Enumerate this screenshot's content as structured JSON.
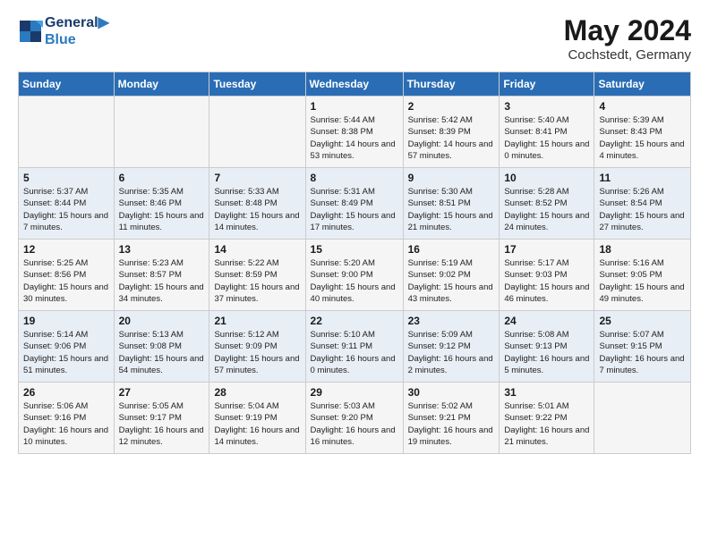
{
  "header": {
    "logo_line1": "General",
    "logo_line2": "Blue",
    "month": "May 2024",
    "location": "Cochstedt, Germany"
  },
  "days_of_week": [
    "Sunday",
    "Monday",
    "Tuesday",
    "Wednesday",
    "Thursday",
    "Friday",
    "Saturday"
  ],
  "weeks": [
    [
      {
        "day": "",
        "info": ""
      },
      {
        "day": "",
        "info": ""
      },
      {
        "day": "",
        "info": ""
      },
      {
        "day": "1",
        "info": "Sunrise: 5:44 AM\nSunset: 8:38 PM\nDaylight: 14 hours and 53 minutes."
      },
      {
        "day": "2",
        "info": "Sunrise: 5:42 AM\nSunset: 8:39 PM\nDaylight: 14 hours and 57 minutes."
      },
      {
        "day": "3",
        "info": "Sunrise: 5:40 AM\nSunset: 8:41 PM\nDaylight: 15 hours and 0 minutes."
      },
      {
        "day": "4",
        "info": "Sunrise: 5:39 AM\nSunset: 8:43 PM\nDaylight: 15 hours and 4 minutes."
      }
    ],
    [
      {
        "day": "5",
        "info": "Sunrise: 5:37 AM\nSunset: 8:44 PM\nDaylight: 15 hours and 7 minutes."
      },
      {
        "day": "6",
        "info": "Sunrise: 5:35 AM\nSunset: 8:46 PM\nDaylight: 15 hours and 11 minutes."
      },
      {
        "day": "7",
        "info": "Sunrise: 5:33 AM\nSunset: 8:48 PM\nDaylight: 15 hours and 14 minutes."
      },
      {
        "day": "8",
        "info": "Sunrise: 5:31 AM\nSunset: 8:49 PM\nDaylight: 15 hours and 17 minutes."
      },
      {
        "day": "9",
        "info": "Sunrise: 5:30 AM\nSunset: 8:51 PM\nDaylight: 15 hours and 21 minutes."
      },
      {
        "day": "10",
        "info": "Sunrise: 5:28 AM\nSunset: 8:52 PM\nDaylight: 15 hours and 24 minutes."
      },
      {
        "day": "11",
        "info": "Sunrise: 5:26 AM\nSunset: 8:54 PM\nDaylight: 15 hours and 27 minutes."
      }
    ],
    [
      {
        "day": "12",
        "info": "Sunrise: 5:25 AM\nSunset: 8:56 PM\nDaylight: 15 hours and 30 minutes."
      },
      {
        "day": "13",
        "info": "Sunrise: 5:23 AM\nSunset: 8:57 PM\nDaylight: 15 hours and 34 minutes."
      },
      {
        "day": "14",
        "info": "Sunrise: 5:22 AM\nSunset: 8:59 PM\nDaylight: 15 hours and 37 minutes."
      },
      {
        "day": "15",
        "info": "Sunrise: 5:20 AM\nSunset: 9:00 PM\nDaylight: 15 hours and 40 minutes."
      },
      {
        "day": "16",
        "info": "Sunrise: 5:19 AM\nSunset: 9:02 PM\nDaylight: 15 hours and 43 minutes."
      },
      {
        "day": "17",
        "info": "Sunrise: 5:17 AM\nSunset: 9:03 PM\nDaylight: 15 hours and 46 minutes."
      },
      {
        "day": "18",
        "info": "Sunrise: 5:16 AM\nSunset: 9:05 PM\nDaylight: 15 hours and 49 minutes."
      }
    ],
    [
      {
        "day": "19",
        "info": "Sunrise: 5:14 AM\nSunset: 9:06 PM\nDaylight: 15 hours and 51 minutes."
      },
      {
        "day": "20",
        "info": "Sunrise: 5:13 AM\nSunset: 9:08 PM\nDaylight: 15 hours and 54 minutes."
      },
      {
        "day": "21",
        "info": "Sunrise: 5:12 AM\nSunset: 9:09 PM\nDaylight: 15 hours and 57 minutes."
      },
      {
        "day": "22",
        "info": "Sunrise: 5:10 AM\nSunset: 9:11 PM\nDaylight: 16 hours and 0 minutes."
      },
      {
        "day": "23",
        "info": "Sunrise: 5:09 AM\nSunset: 9:12 PM\nDaylight: 16 hours and 2 minutes."
      },
      {
        "day": "24",
        "info": "Sunrise: 5:08 AM\nSunset: 9:13 PM\nDaylight: 16 hours and 5 minutes."
      },
      {
        "day": "25",
        "info": "Sunrise: 5:07 AM\nSunset: 9:15 PM\nDaylight: 16 hours and 7 minutes."
      }
    ],
    [
      {
        "day": "26",
        "info": "Sunrise: 5:06 AM\nSunset: 9:16 PM\nDaylight: 16 hours and 10 minutes."
      },
      {
        "day": "27",
        "info": "Sunrise: 5:05 AM\nSunset: 9:17 PM\nDaylight: 16 hours and 12 minutes."
      },
      {
        "day": "28",
        "info": "Sunrise: 5:04 AM\nSunset: 9:19 PM\nDaylight: 16 hours and 14 minutes."
      },
      {
        "day": "29",
        "info": "Sunrise: 5:03 AM\nSunset: 9:20 PM\nDaylight: 16 hours and 16 minutes."
      },
      {
        "day": "30",
        "info": "Sunrise: 5:02 AM\nSunset: 9:21 PM\nDaylight: 16 hours and 19 minutes."
      },
      {
        "day": "31",
        "info": "Sunrise: 5:01 AM\nSunset: 9:22 PM\nDaylight: 16 hours and 21 minutes."
      },
      {
        "day": "",
        "info": ""
      }
    ]
  ]
}
